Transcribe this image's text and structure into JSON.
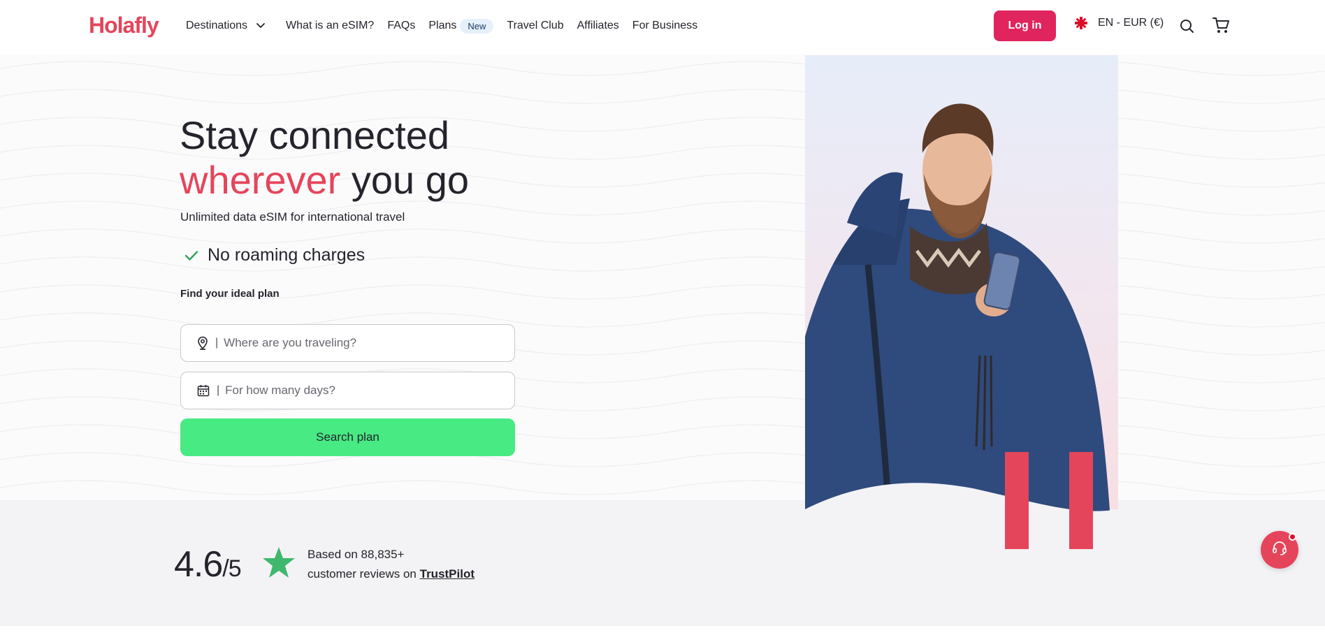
{
  "header": {
    "logo": "Holafly",
    "nav": [
      {
        "label": "Destinations"
      },
      {
        "label": "What is an eSIM?"
      },
      {
        "label": "FAQs"
      },
      {
        "label": "Plans",
        "badge": "New"
      },
      {
        "label": "Travel Club"
      },
      {
        "label": "Affiliates"
      },
      {
        "label": "For Business"
      }
    ],
    "login_label": "Log in",
    "language_label": "EN - EUR (€)"
  },
  "hero": {
    "headline_line1": "Stay connected",
    "headline_accent": "wherever",
    "headline_rest": " you go",
    "subtitle": "Unlimited data eSIM for international travel",
    "feature": "No roaming charges",
    "find_label": "Find your ideal plan",
    "separator": "|",
    "destination_placeholder": "Where are you traveling?",
    "days_placeholder": "For how many days?",
    "search_button": "Search plan"
  },
  "rating": {
    "score": "4.6",
    "out_of": "/5",
    "text_line1": "Based on 88,835+",
    "text_line2": "customer reviews on ",
    "trustpilot_label": "TrustPilot"
  },
  "colors": {
    "brand": "#e5455a",
    "login": "#e0245e",
    "cta": "#48ea83",
    "check": "#2fa35a",
    "star": "#3fb86d"
  },
  "icons": [
    "chevron-down-icon",
    "uk-flag-icon",
    "search-icon",
    "cart-icon",
    "check-icon",
    "location-pin-icon",
    "calendar-icon",
    "star-icon",
    "chat-support-icon"
  ]
}
